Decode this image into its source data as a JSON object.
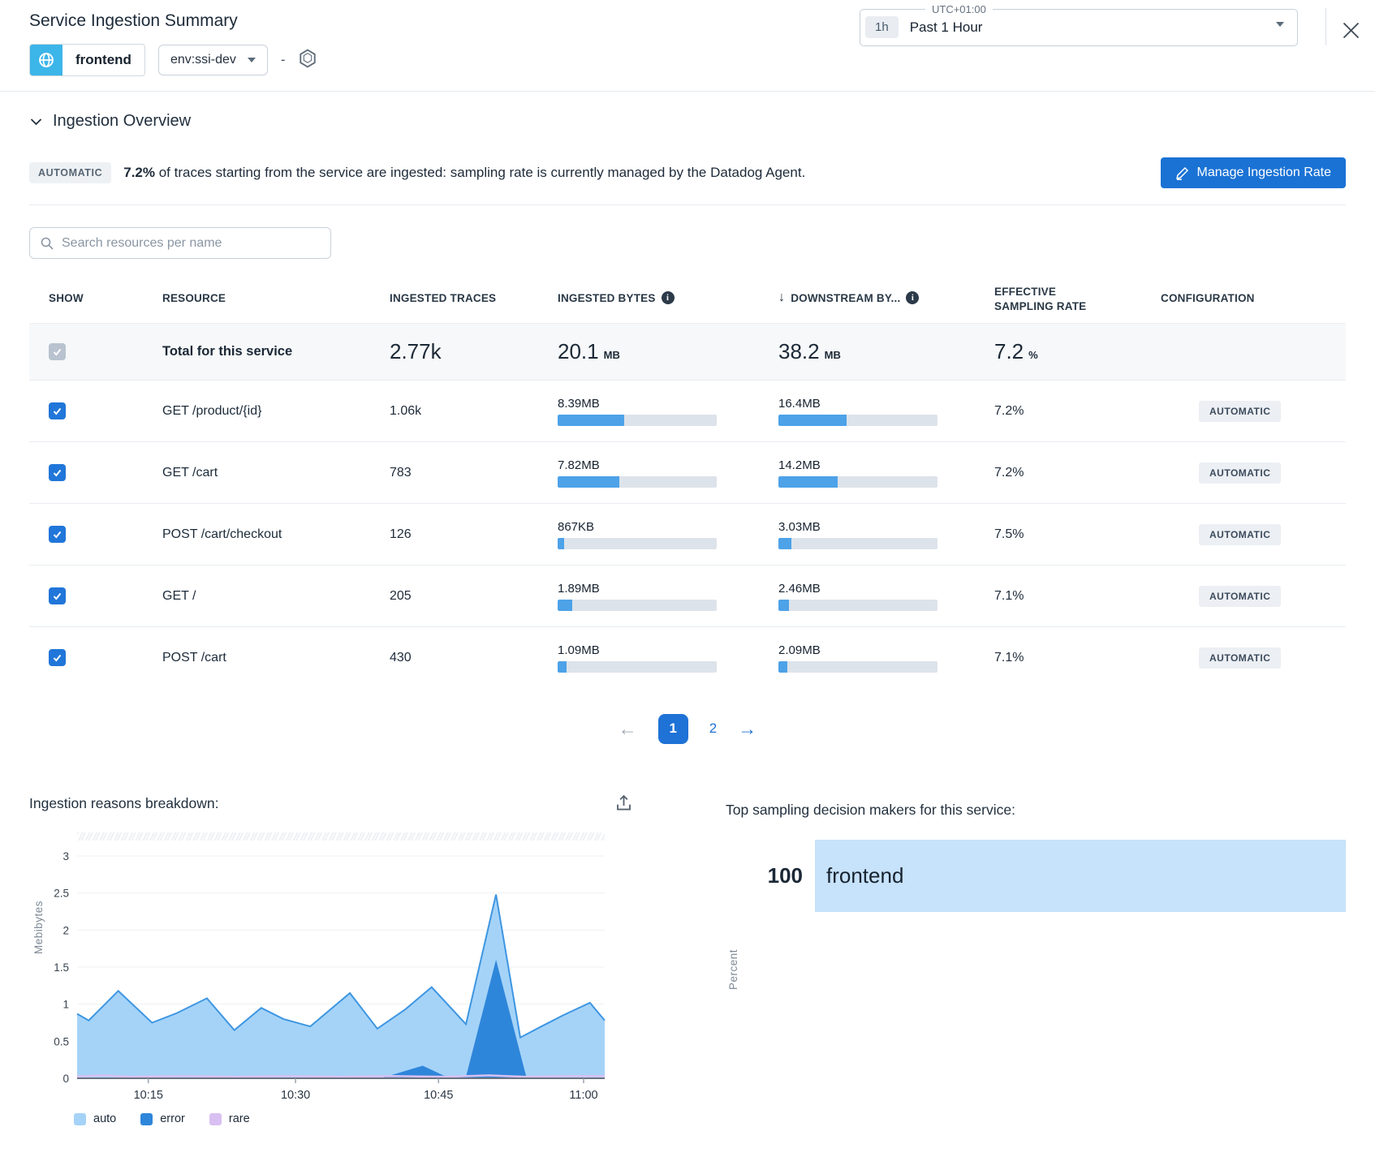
{
  "header": {
    "title": "Service Ingestion Summary",
    "service_name": "frontend",
    "env_selector": "env:ssi-dev",
    "env_separator": "-",
    "time_picker": {
      "timezone": "UTC+01:00",
      "shortcut": "1h",
      "label": "Past 1 Hour"
    }
  },
  "overview": {
    "section_title": "Ingestion Overview",
    "badge": "AUTOMATIC",
    "rate_bold": "7.2%",
    "description": " of traces starting from the service are ingested: sampling rate is currently managed by the Datadog Agent.",
    "manage_button": "Manage Ingestion Rate"
  },
  "search": {
    "placeholder": "Search resources per name"
  },
  "table": {
    "columns": [
      "SHOW",
      "RESOURCE",
      "INGESTED TRACES",
      "INGESTED BYTES",
      "DOWNSTREAM BY...",
      "EFFECTIVE SAMPLING RATE",
      "CONFIGURATION"
    ],
    "totals": {
      "bytes_mb": 20.1,
      "downstream_mb": 38.2
    },
    "total_row": {
      "label": "Total for this service",
      "traces": "2.77k",
      "bytes_value": "20.1",
      "bytes_unit": "MB",
      "downstream_value": "38.2",
      "downstream_unit": "MB",
      "rate_value": "7.2",
      "rate_unit": "%"
    },
    "rows": [
      {
        "resource": "GET /product/{id}",
        "traces": "1.06k",
        "bytes_label": "8.39MB",
        "bytes_mb": 8.39,
        "downstream_label": "16.4MB",
        "downstream_mb": 16.4,
        "rate": "7.2%",
        "config": "AUTOMATIC",
        "checked": true
      },
      {
        "resource": "GET /cart",
        "traces": "783",
        "bytes_label": "7.82MB",
        "bytes_mb": 7.82,
        "downstream_label": "14.2MB",
        "downstream_mb": 14.2,
        "rate": "7.2%",
        "config": "AUTOMATIC",
        "checked": true
      },
      {
        "resource": "POST /cart/checkout",
        "traces": "126",
        "bytes_label": "867KB",
        "bytes_mb": 0.867,
        "downstream_label": "3.03MB",
        "downstream_mb": 3.03,
        "rate": "7.5%",
        "config": "AUTOMATIC",
        "checked": true
      },
      {
        "resource": "GET /",
        "traces": "205",
        "bytes_label": "1.89MB",
        "bytes_mb": 1.89,
        "downstream_label": "2.46MB",
        "downstream_mb": 2.46,
        "rate": "7.1%",
        "config": "AUTOMATIC",
        "checked": true
      },
      {
        "resource": "POST /cart",
        "traces": "430",
        "bytes_label": "1.09MB",
        "bytes_mb": 1.09,
        "downstream_label": "2.09MB",
        "downstream_mb": 2.09,
        "rate": "7.1%",
        "config": "AUTOMATIC",
        "checked": true
      }
    ]
  },
  "pagination": {
    "prev_icon": "←",
    "next_icon": "→",
    "pages": [
      "1",
      "2"
    ],
    "active_page": "1"
  },
  "chart_data": [
    {
      "type": "area",
      "title": "Ingestion reasons breakdown:",
      "ylabel": "Mebibytes",
      "ylim": [
        0,
        3
      ],
      "yticks": [
        0,
        0.5,
        1,
        1.5,
        2,
        2.5,
        3
      ],
      "grid": true,
      "legend": [
        "auto",
        "error",
        "rare"
      ],
      "legend_position": "bottom-left",
      "colors": {
        "auto": "#a5d3f8",
        "auto_stroke": "#3e96e1",
        "error": "#2e86da",
        "rare": "#d9c0f2"
      },
      "xticks": [
        {
          "label": "10:15",
          "f": 0.135
        },
        {
          "label": "10:30",
          "f": 0.414
        },
        {
          "label": "10:45",
          "f": 0.685
        },
        {
          "label": "11:00",
          "f": 0.96
        }
      ],
      "series": [
        {
          "name": "auto",
          "x_f": [
            0,
            0.022,
            0.078,
            0.142,
            0.189,
            0.246,
            0.298,
            0.349,
            0.391,
            0.442,
            0.517,
            0.569,
            0.622,
            0.672,
            0.737,
            0.794,
            0.84,
            0.88,
            0.921,
            0.972,
            1.0
          ],
          "values": [
            0.87,
            0.78,
            1.18,
            0.75,
            0.88,
            1.08,
            0.65,
            0.95,
            0.8,
            0.7,
            1.15,
            0.67,
            0.93,
            1.23,
            0.73,
            2.48,
            0.55,
            0.7,
            0.85,
            1.02,
            0.78
          ]
        },
        {
          "name": "error",
          "x_f": [
            0,
            0.58,
            0.655,
            0.7,
            0.737,
            0.794,
            0.851,
            0.9,
            1.0
          ],
          "values": [
            0.01,
            0.01,
            0.17,
            0.02,
            0.02,
            1.6,
            0.03,
            0.01,
            0.01
          ]
        },
        {
          "name": "rare",
          "x_f": [
            0,
            0.05,
            0.1,
            0.2,
            0.3,
            0.4,
            0.5,
            0.6,
            0.7,
            0.78,
            0.85,
            0.93,
            1.0
          ],
          "values": [
            0.025,
            0.04,
            0.02,
            0.03,
            0.02,
            0.03,
            0.02,
            0.03,
            0.02,
            0.04,
            0.02,
            0.03,
            0.03
          ]
        }
      ]
    },
    {
      "type": "bar",
      "orientation": "horizontal",
      "title": "Top sampling decision makers for this service:",
      "ylabel": "Percent",
      "categories": [
        "frontend"
      ],
      "values": [
        100
      ],
      "bar_color": "#c7e2fb",
      "xlim": [
        0,
        100
      ]
    }
  ]
}
